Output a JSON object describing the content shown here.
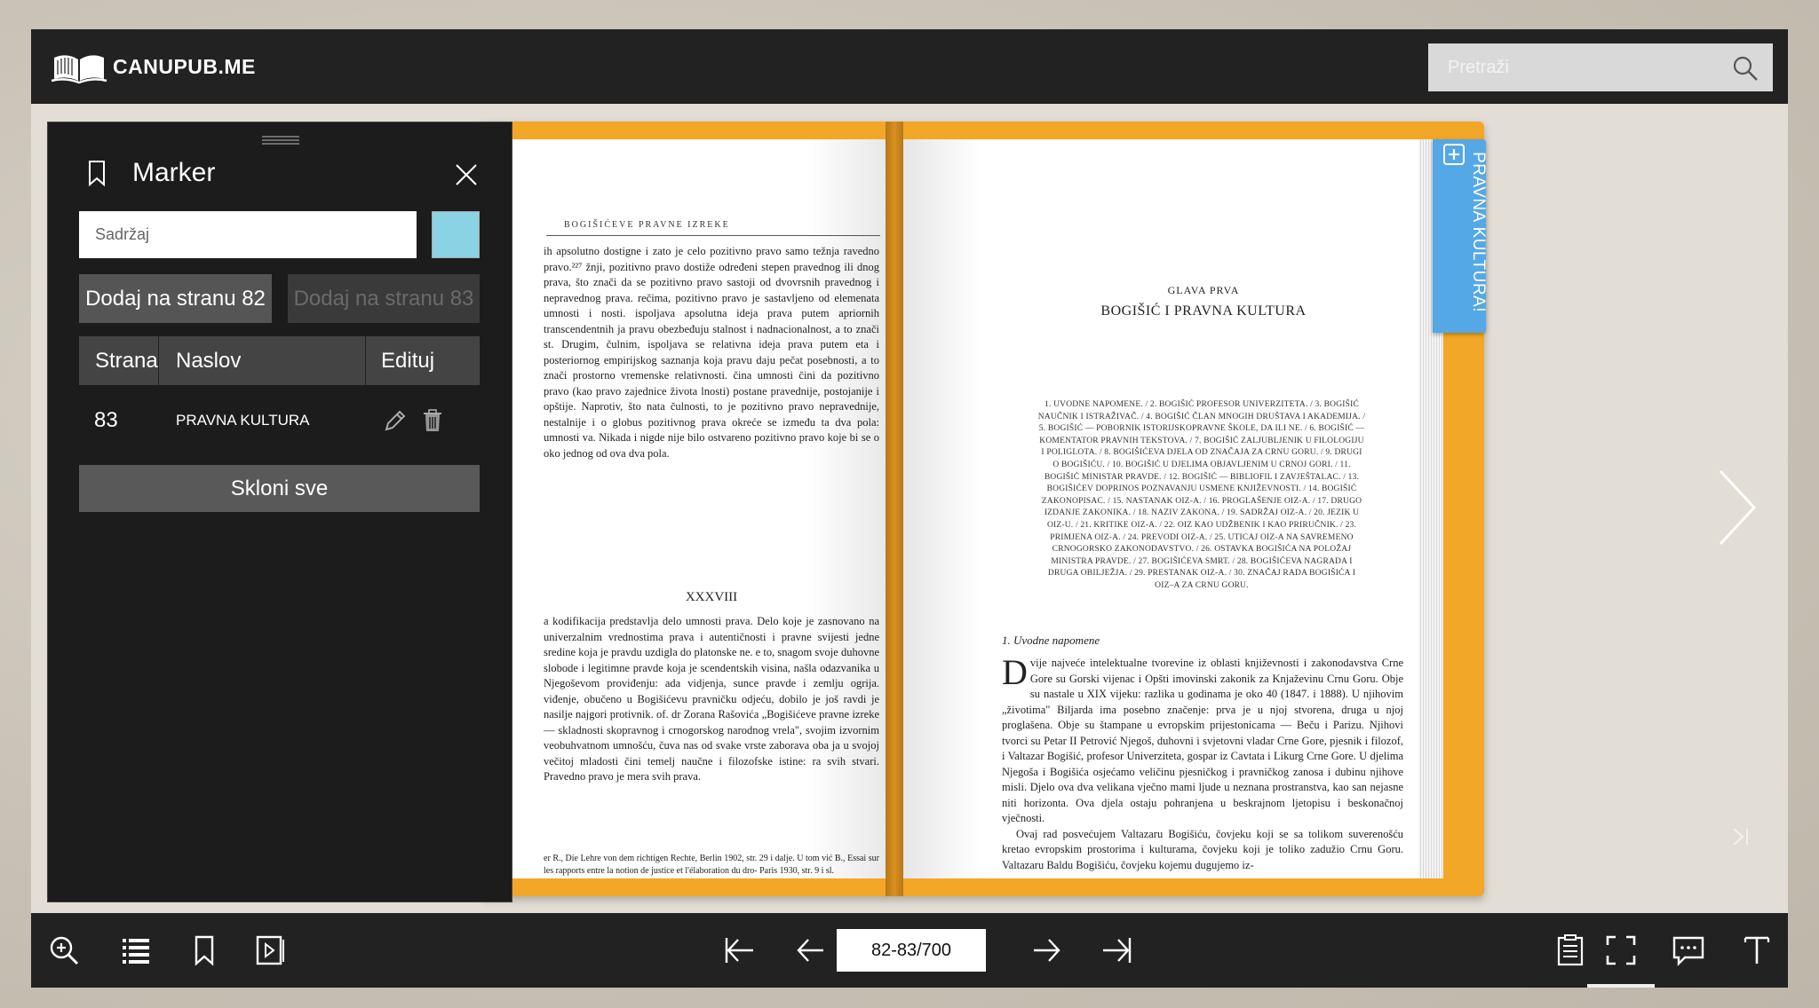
{
  "header": {
    "brand": "CANUPUB.ME",
    "search_placeholder": "Pretraži"
  },
  "book": {
    "left_page": {
      "running_head": "BOGIŠIĆEVE PRAVNE IZREKE",
      "body_top": "ih apsolutno dostigne i zato je celo pozitivno pravo samo težnja ravedno pravo.²²⁷ žnji, pozitivno pravo dostiže određeni stepen pravednog ili dnog prava, što znači da se pozitivno pravo sastoji od dvovrsnih pravednog i nepravednog prava. rečima, pozitivno pravo je sastavljeno od elemenata umnosti i nosti. ispoljava apsolutna ideja prava putem apriornih transcendentnih ja pravu obezbeđuju stalnost i nadnacionalnost, a to znači st. Drugim, čulnim, ispoljava se relativna ideja prava putem eta i posteriornog empirijskog saznanja koja pravu daju pečat posebnosti, a to znači prostorno vremenske relativnosti. čina umnosti čini da pozitivno pravo (kao pravo zajednice života lnosti) postane pravednije, postojanije i opštije. Naprotiv, što nata čulnosti, to je pozitivno pravo nepravednije, nestalnije i o globus pozitivnog prava okreće se između ta dva pola: umnosti va. Nikada i nigde nije bilo ostvareno pozitivno pravo koje bi se o oko jednog od ova dva pola.",
      "roman": "XXXVIII",
      "body_bottom": "a kodifikacija predstavlja delo umnosti prava. Delo koje je zasnovano na univerzalnim vrednostima prava i autentičnosti i pravne svijesti jedne sredine koja je pravdu uzdigla do platonske ne. e to, snagom svoje duhovne slobode i legitimne pravde koja je scendentskih visina, našla odazvanika u Njegoševom proviđenju: ada vidjenja, sunce pravde i zemlju ogrija. viđenje, obučeno u Bogišićevu pravničku odjeću, dobilo je još ravdi je nasilje najgori protivnik. of. dr Zorana Rašovića „Bogišićeve pravne izreke — skladnosti skopravnog i crnogorskog narodnog vrela\", svojim izvornim veobuhvatnom umnošću, čuva nas od svake vrste zaborava oba ja u svojoj večitoj mladosti čini temelj naučne i filozofske istine: ra svih stvari. Pravedno pravo je mera svih prava.",
      "footnote": "er R., Die Lehre von dem richtigen Rechte, Berlin 1902, str. 29 i dalje. U tom vić B., Essai sur les rapports entre la notion de justice et l'élaboration du dro- Paris 1930, str. 9 i sl."
    },
    "right_page": {
      "chapter": "GLAVA PRVA",
      "title": "BOGIŠIĆ I PRAVNA KULTURA",
      "summary": "1. UVODNE NAPOMENE. / 2. BOGIŠIĆ PROFESOR UNIVERZITETA. / 3. BOGIŠIĆ NAUČNIK I ISTRAŽIVAČ. / 4. BOGIŠIĆ ČLAN MNOGIH DRUŠTAVA I AKADEMIJA. / 5. BOGIŠIĆ — POBORNIK ISTORIJSKOPRAVNE ŠKOLE, DA ILI NE. / 6. BOGIŠIĆ — KOMENTATOR PRAVNIH TEKSTOVA. / 7. BOGIŠIĆ ZALJUBLJENIK U FILOLOGIJU I POLIGLOTA. / 8. BOGIŠIĆEVA DJELA OD ZNAČAJA ZA CRNU GORU. / 9. DRUGI O BOGIŠIĆU. / 10. BOGIŠIĆ U DJELIMA OBJAVLJENIM U CRNOJ GORI. / 11. BOGIŠIĆ MINISTAR PRAVDE. / 12. BOGIŠIĆ — BIBLIOFIL I ZAVJEŠTALAC. / 13. BOGIŠIĆEV DOPRINOS POZNAVANJU USMENE KNJIŽEVNOSTI. / 14. BOGIŠIĆ ZAKONOPISAC. / 15. NASTANAK OIZ-A. / 16. PROGLAŠENJE OIZ-A. / 17. DRUGO IZDANJE ZAKONIKA. / 18. NAZIV ZAKONA. / 19. SADRŽAJ OIZ-A. / 20. JEZIK U OIZ-U. / 21. KRITIKE OIZ-A. / 22. OIZ KAO UDŽBENIK I KAO PRIRUČNIK. / 23. PRIMJENA OIZ-A. / 24. PREVODI OIZ-A. / 25. UTICAJ OIZ-A NA SAVREMENO CRNOGORSKO ZAKONODAVSTVO. / 26. OSTAVKA BOGIŠIĆA NA POLOŽAJ MINISTRA PRAVDE. / 27. BOGIŠIĆEVA SMRT. / 28. BOGIŠIĆEVA NAGRADA I DRUGA OBILJEŽJA. / 29. PRESTANAK OIZ-A. / 30. ZNAČAJ RADA BOGIŠIĆA I OIZ–A ZA CRNU GORU.",
      "section": "1. Uvodne napomene",
      "dropcap": "D",
      "body": "vije najveće intelektualne tvorevine iz oblasti književnosti i zakonodavstva Crne Gore su Gorski vijenac i Opšti imovinski zakonik za Knjaževinu Crnu Goru. Obje su nastale u XIX vijeku: razlika u godinama je oko 40 (1847. i 1888). U njihovim „životima\" Biljarda ima posebno značenje: prva je u njoj stvorena, druga u njoj proglašena. Obje su štampane u evropskim prijestonicama — Beču i Parizu. Njihovi tvorci su Petar II Petrović Njegoš, duhovni i svjetovni vladar Crne Gore, pjesnik i filozof, i Valtazar Bogišić, profesor Univerziteta, gospar iz Cavtata i Likurg Crne Gore. U djelima Njegoša i Bogišića osjećamo veličinu pjesničkog i pravničkog zanosa i dubinu njihove misli. Djelo ova dva velikana vječno mami ljude u neznana prostranstva, kao san nejasne niti horizonta. Ova djela ostaju pohranjena u beskrajnom ljetopisu i beskonačnoj vječnosti.",
      "body2": "Ovaj rad posvećujem Valtazaru Bogišiću, čovjeku koji se sa tolikom suverenošću kretao evropskim prostorima i kulturama, čovjeku koji je toliko zadužio Crnu Goru. Valtazaru Baldu Bogišiću, čovjeku kojemu dugujemo iz-"
    },
    "marker_tab_label": "PRAVNA KULTURA!"
  },
  "marker_panel": {
    "title": "Marker",
    "content_placeholder": "Sadržaj",
    "color": "#89d3e4",
    "add_left_label": "Dodaj na stranu 82",
    "add_right_label": "Dodaj na stranu 83",
    "columns": [
      "Strana",
      "Naslov",
      "Edituj"
    ],
    "rows": [
      {
        "page": "83",
        "title": "PRAVNA KULTURA"
      }
    ],
    "clear_all_label": "Skloni sve"
  },
  "toolbar": {
    "page_indicator": "82-83/700"
  },
  "colors": {
    "header_bg": "#222222",
    "cover": "#f2a726",
    "marker_tab": "#55a8e6",
    "panel_bg": "#1c1c1c"
  }
}
